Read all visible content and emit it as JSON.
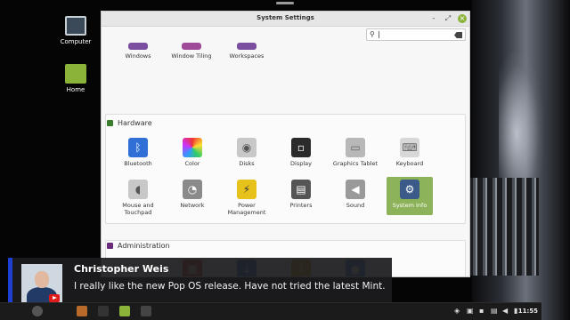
{
  "desktop": {
    "icons": [
      {
        "label": "Computer",
        "icon": "monitor-icon"
      },
      {
        "label": "Home",
        "icon": "folder-icon"
      }
    ]
  },
  "window": {
    "title": "System Settings",
    "controls": {
      "minimize": "-",
      "maximize": "⤢",
      "close": "×"
    },
    "search": {
      "value": "",
      "caret": "|"
    }
  },
  "sections": {
    "top_row": [
      {
        "label": "Windows",
        "icon": "windows-icon",
        "color": "#7b4fa0"
      },
      {
        "label": "Window Tiling",
        "icon": "window-tiling-icon",
        "color": "#a04a9a"
      },
      {
        "label": "Workspaces",
        "icon": "workspaces-icon",
        "color": "#7b4fa0"
      }
    ],
    "hardware": {
      "title": "Hardware",
      "accent": "#3a7d2c",
      "items": [
        {
          "label": "Bluetooth",
          "icon": "bluetooth-icon",
          "color": "#2f6fd6"
        },
        {
          "label": "Color",
          "icon": "color-icon",
          "color": "#e06a3a"
        },
        {
          "label": "Disks",
          "icon": "disks-icon",
          "color": "#c8c8c8"
        },
        {
          "label": "Display",
          "icon": "display-icon",
          "color": "#2b2b2b"
        },
        {
          "label": "Graphics Tablet",
          "icon": "graphics-tablet-icon",
          "color": "#b8b8b8"
        },
        {
          "label": "Keyboard",
          "icon": "keyboard-icon",
          "color": "#d8d8d8"
        },
        {
          "label": "Mouse and Touchpad",
          "icon": "mouse-icon",
          "color": "#c8c8c8"
        },
        {
          "label": "Network",
          "icon": "network-icon",
          "color": "#8a8a8a"
        },
        {
          "label": "Power Management",
          "icon": "power-icon",
          "color": "#e6c21a"
        },
        {
          "label": "Printers",
          "icon": "printer-icon",
          "color": "#555555"
        },
        {
          "label": "Sound",
          "icon": "sound-icon",
          "color": "#9a9a9a"
        },
        {
          "label": "System Info",
          "icon": "gear-icon",
          "color": "#3b5a8a",
          "selected": true
        }
      ]
    },
    "administration": {
      "title": "Administration",
      "accent": "#6a2c7a",
      "items": [
        {
          "icon": "firewall-icon",
          "color": "#d0502a"
        },
        {
          "icon": "download-icon",
          "color": "#2f6fd6"
        },
        {
          "icon": "info-icon",
          "color": "#e8a21a"
        },
        {
          "icon": "users-icon",
          "color": "#3f7ad8"
        }
      ]
    }
  },
  "chat": {
    "name": "Christopher Weis",
    "message": "I really like the new Pop OS release. Have not tried the latest Mint."
  },
  "panel": {
    "clock": "11:55"
  }
}
